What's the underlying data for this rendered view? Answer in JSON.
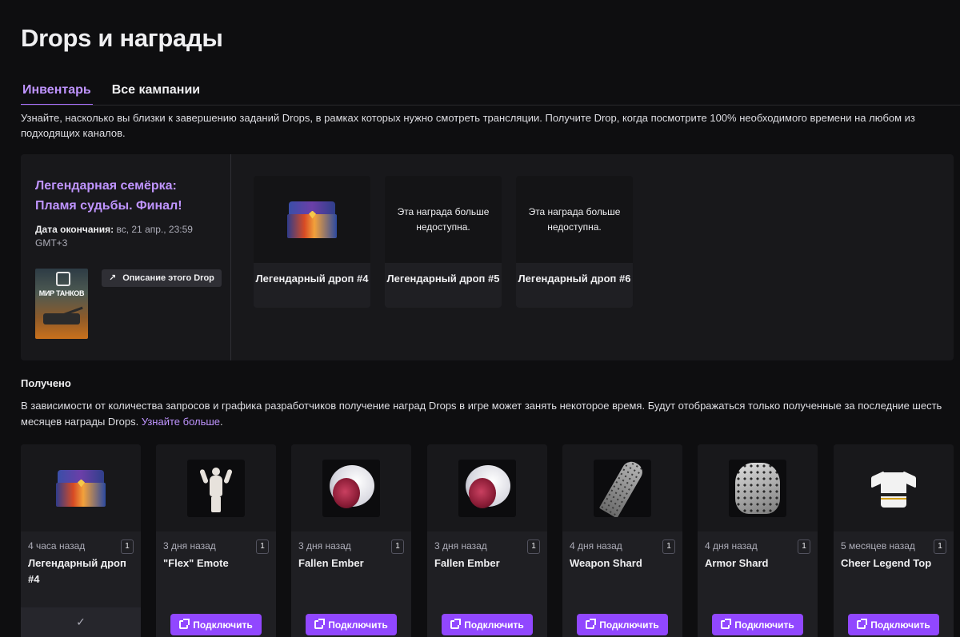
{
  "page_title": "Drops и награды",
  "tabs": [
    {
      "label": "Инвентарь",
      "active": true
    },
    {
      "label": "Все кампании",
      "active": false
    }
  ],
  "intro": "Узнайте, насколько вы близки к завершению заданий Drops, в рамках которых нужно смотреть трансляции. Получите Drop, когда посмотрите 100% необходимого времени на любом из подходящих каналов.",
  "campaign": {
    "name": "Легендарная семёрка: Пламя судьбы. Финал!",
    "end_label": "Дата окончания:",
    "end_value": " вс, 21 апр., 23:59 GMT+3",
    "game_logo": "МИР ТАНКОВ",
    "description_button": "Описание этого Drop",
    "drops": [
      {
        "name": "Легендарный дроп #4",
        "available": true,
        "unavailable_text": ""
      },
      {
        "name": "Легендарный дроп #5",
        "available": false,
        "unavailable_text": "Эта награда больше недоступна."
      },
      {
        "name": "Легендарный дроп #6",
        "available": false,
        "unavailable_text": "Эта награда больше недоступна."
      }
    ]
  },
  "received": {
    "title": "Получено",
    "text": "В зависимости от количества запросов и графика разработчиков получение наград Drops в игре может занять некоторое время. Будут отображаться только полученные за последние шесть месяцев награды Drops. ",
    "learn_more": "Узнайте больше",
    "text_end": ".",
    "connect_label": "Подключить",
    "items": [
      {
        "time": "4 часа назад",
        "count": "1",
        "name": "Легендарный дроп #4",
        "icon": "chest",
        "claimed": true
      },
      {
        "time": "3 дня назад",
        "count": "1",
        "name": "\"Flex\" Emote",
        "icon": "flex-emote",
        "claimed": false
      },
      {
        "time": "3 дня назад",
        "count": "1",
        "name": "Fallen Ember",
        "icon": "ember",
        "claimed": false
      },
      {
        "time": "3 дня назад",
        "count": "1",
        "name": "Fallen Ember",
        "icon": "ember",
        "claimed": false
      },
      {
        "time": "4 дня назад",
        "count": "1",
        "name": "Weapon Shard",
        "icon": "weapon-shard",
        "claimed": false
      },
      {
        "time": "4 дня назад",
        "count": "1",
        "name": "Armor Shard",
        "icon": "armor-shard",
        "claimed": false
      },
      {
        "time": "5 месяцев назад",
        "count": "1",
        "name": "Cheer Legend Top",
        "icon": "shirt",
        "claimed": false
      }
    ]
  },
  "colors": {
    "accent": "#9147ff",
    "accent_text": "#bf94ff",
    "background": "#0e0e10",
    "card": "#1f1f23"
  }
}
